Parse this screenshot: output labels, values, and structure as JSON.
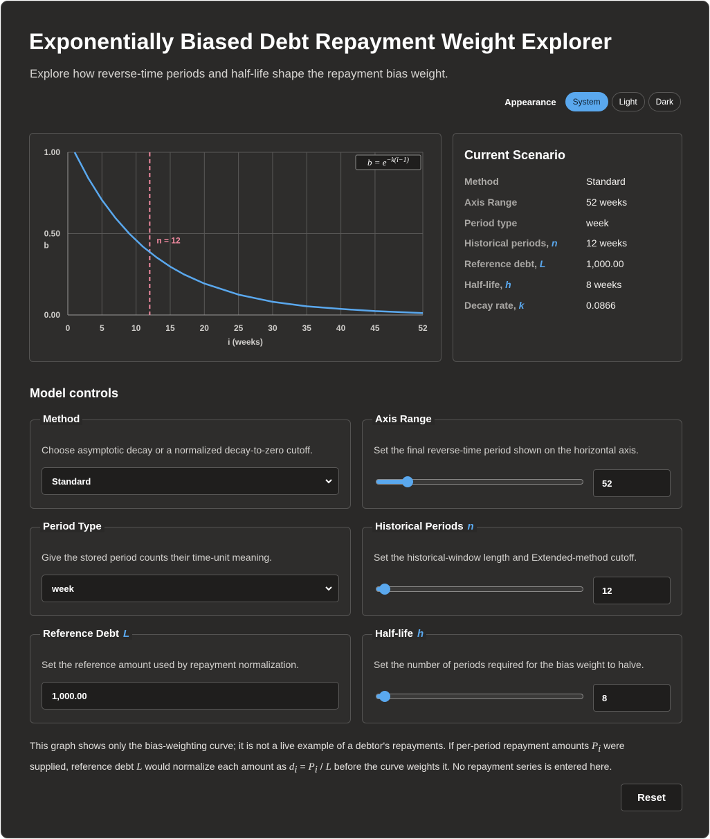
{
  "app": {
    "title": "Exponentially Biased Debt Repayment Weight Explorer",
    "subtitle": "Explore how reverse-time periods and half-life shape the repayment bias weight."
  },
  "appearance": {
    "label": "Appearance",
    "options": [
      "System",
      "Light",
      "Dark"
    ],
    "selected": "System"
  },
  "chart_data": {
    "type": "line",
    "title": "",
    "formula": "b = e^{-k(i-1)}",
    "xlabel": "i (weeks)",
    "ylabel": "b",
    "xlim": [
      0,
      52
    ],
    "ylim": [
      0,
      1
    ],
    "x_ticks": [
      "0",
      "5",
      "10",
      "15",
      "20",
      "25",
      "30",
      "35",
      "40",
      "45",
      "52"
    ],
    "y_ticks": [
      "1.00",
      "0.50",
      "0.00"
    ],
    "grid": true,
    "marker": {
      "x": 12,
      "label": "n = 12",
      "color": "#f08aa0"
    },
    "series": [
      {
        "color": "#5aa8ee",
        "x": [
          1,
          3,
          5,
          7,
          9,
          11,
          13,
          15,
          17,
          20,
          25,
          30,
          35,
          40,
          45,
          52
        ],
        "y": [
          1.0,
          0.841,
          0.707,
          0.595,
          0.5,
          0.42,
          0.354,
          0.297,
          0.25,
          0.193,
          0.125,
          0.081,
          0.053,
          0.037,
          0.024,
          0.012
        ]
      }
    ]
  },
  "scenario": {
    "title": "Current Scenario",
    "rows": [
      {
        "key": "Method",
        "sym": "",
        "value": "Standard"
      },
      {
        "key": "Axis Range",
        "sym": "",
        "value": "52 weeks"
      },
      {
        "key": "Period type",
        "sym": "",
        "value": "week"
      },
      {
        "key": "Historical periods,",
        "sym": "n",
        "value": "12 weeks"
      },
      {
        "key": "Reference debt,",
        "sym": "L",
        "value": "1,000.00"
      },
      {
        "key": "Half-life,",
        "sym": "h",
        "value": "8 weeks"
      },
      {
        "key": "Decay rate,",
        "sym": "k",
        "value": "0.0866"
      }
    ]
  },
  "controls": {
    "section_title": "Model controls",
    "method": {
      "legend": "Method",
      "desc": "Choose asymptotic decay or a normalized decay-to-zero cutoff.",
      "value": "Standard"
    },
    "axis_range": {
      "legend": "Axis Range",
      "desc": "Set the final reverse-time period shown on the horizontal axis.",
      "value": "52",
      "fraction": 0.15
    },
    "period_type": {
      "legend": "Period Type",
      "desc": "Give the stored period counts their time-unit meaning.",
      "value": "week"
    },
    "historical_periods": {
      "legend": "Historical Periods",
      "sym": "n",
      "desc": "Set the historical-window length and Extended-method cutoff.",
      "value": "12",
      "fraction": 0.04
    },
    "reference_debt": {
      "legend": "Reference Debt",
      "sym": "L",
      "desc": "Set the reference amount used by repayment normalization.",
      "value": "1,000.00"
    },
    "half_life": {
      "legend": "Half-life",
      "sym": "h",
      "desc": "Set the number of periods required for the bias weight to halve.",
      "value": "8",
      "fraction": 0.04
    }
  },
  "footnote": {
    "part1": "This graph shows only the bias-weighting curve; it is not a live example of a debtor's repayments. If per-period repayment amounts ",
    "p_sym": "P",
    "p_sub": "i",
    "part2": " were supplied, reference debt ",
    "l_sym": "L",
    "part3": " would normalize each amount as ",
    "d_sym": "d",
    "d_sub": "i",
    "eq": " = ",
    "p2_sym": "P",
    "p2_sub": "i",
    "div": " / ",
    "l2_sym": "L",
    "part4": " before the curve weights it. No repayment series is entered here."
  },
  "reset_label": "Reset"
}
